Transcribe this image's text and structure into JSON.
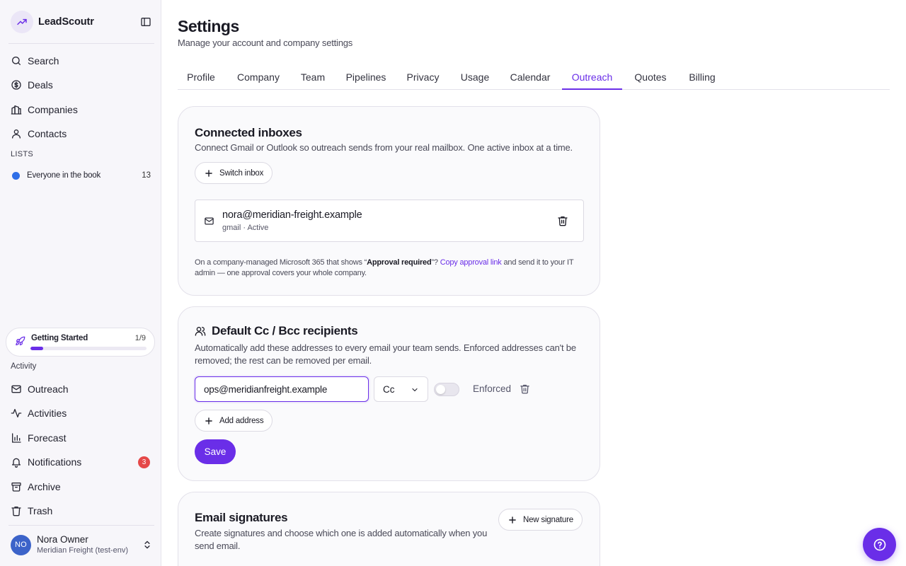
{
  "app": {
    "name": "LeadScoutr"
  },
  "sidebar": {
    "nav": [
      {
        "label": "Search",
        "icon": "search-icon"
      },
      {
        "label": "Deals",
        "icon": "dollar-circle-icon"
      },
      {
        "label": "Companies",
        "icon": "building-icon"
      },
      {
        "label": "Contacts",
        "icon": "user-icon"
      }
    ],
    "lists_heading": "LISTS",
    "lists": [
      {
        "label": "Everyone in the book",
        "count": "13",
        "color": "#2f6fe8"
      }
    ],
    "getting_started": {
      "label": "Getting Started",
      "progress_text": "1/9",
      "progress": 0.111
    },
    "activity_heading": "Activity",
    "activity": [
      {
        "label": "Outreach",
        "icon": "mail-icon"
      },
      {
        "label": "Activities",
        "icon": "activity-pulse-icon"
      },
      {
        "label": "Forecast",
        "icon": "bar-chart-icon"
      },
      {
        "label": "Notifications",
        "icon": "bell-icon",
        "badge": "3"
      },
      {
        "label": "Archive",
        "icon": "archive-icon"
      },
      {
        "label": "Trash",
        "icon": "trash-icon"
      }
    ],
    "user": {
      "initials": "NO",
      "name": "Nora Owner",
      "org": "Meridian Freight (test-env)"
    }
  },
  "page": {
    "title": "Settings",
    "subtitle": "Manage your account and company settings"
  },
  "tabs": [
    {
      "label": "Profile"
    },
    {
      "label": "Company"
    },
    {
      "label": "Team"
    },
    {
      "label": "Pipelines"
    },
    {
      "label": "Privacy"
    },
    {
      "label": "Usage"
    },
    {
      "label": "Calendar"
    },
    {
      "label": "Outreach",
      "active": true
    },
    {
      "label": "Quotes"
    },
    {
      "label": "Billing"
    }
  ],
  "inboxes": {
    "title": "Connected inboxes",
    "description": "Connect Gmail or Outlook so outreach sends from your real mailbox. One active inbox at a time.",
    "switch_label": "Switch inbox",
    "inbox": {
      "email": "nora@meridian-freight.example",
      "status": "gmail · Active"
    },
    "note_before": "On a company-managed Microsoft 365 that shows “",
    "note_strong": "Approval required",
    "note_mid": "”? ",
    "note_link": "Copy approval link",
    "note_after": " and send it to your IT admin — one approval covers your whole company."
  },
  "ccbcc": {
    "title": "Default Cc / Bcc recipients",
    "description": "Automatically add these addresses to every email your team sends. Enforced addresses can't be removed; the rest can be removed per email.",
    "row": {
      "address": "ops@meridianfreight.example",
      "type": "Cc",
      "enforced_label": "Enforced",
      "enforced": false
    },
    "add_label": "Add address",
    "save_label": "Save"
  },
  "signatures": {
    "title": "Email signatures",
    "description": "Create signatures and choose which one is added automatically when you send email.",
    "new_label": "New signature"
  },
  "colors": {
    "accent": "#6a2ee8",
    "badge": "#e54848",
    "avatar": "#3c63c9"
  }
}
